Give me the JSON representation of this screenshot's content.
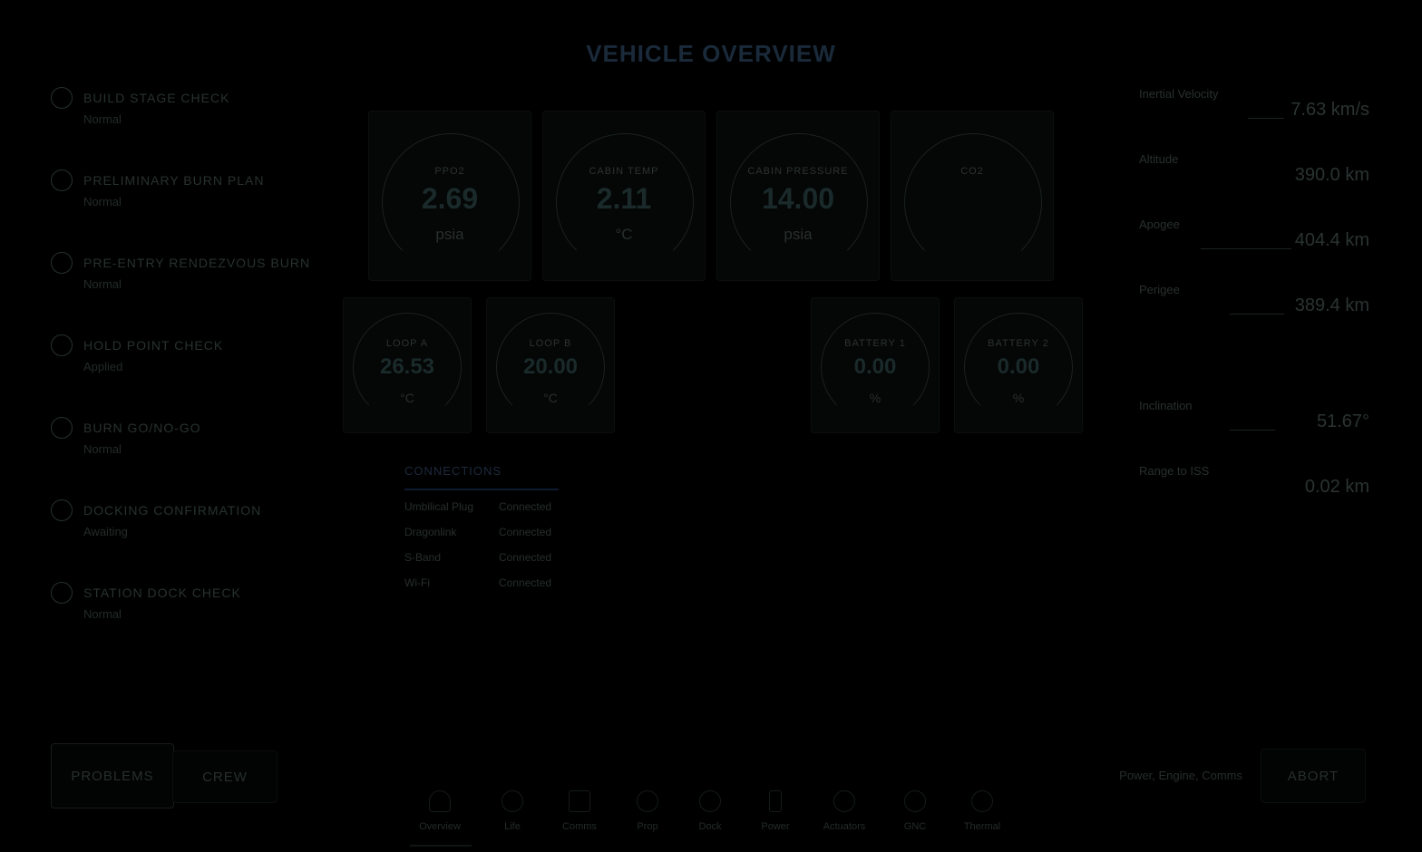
{
  "title": "VEHICLE OVERVIEW",
  "checklist": [
    {
      "name": "BUILD STAGE CHECK",
      "status": "Normal"
    },
    {
      "name": "PRELIMINARY BURN PLAN",
      "status": "Normal"
    },
    {
      "name": "PRE-ENTRY RENDEZVOUS BURN",
      "status": "Normal"
    },
    {
      "name": "HOLD POINT CHECK",
      "status": "Applied"
    },
    {
      "name": "BURN GO/NO-GO",
      "status": "Normal"
    },
    {
      "name": "DOCKING CONFIRMATION",
      "status": "Awaiting"
    },
    {
      "name": "STATION DOCK CHECK",
      "status": "Normal"
    }
  ],
  "gauges_top": [
    {
      "label": "PPO2",
      "value": "2.69",
      "unit": "psia"
    },
    {
      "label": "CABIN TEMP",
      "value": "2.11",
      "unit": "°C"
    },
    {
      "label": "CABIN PRESSURE",
      "value": "14.00",
      "unit": "psia"
    },
    {
      "label": "CO2",
      "value": "",
      "unit": ""
    }
  ],
  "gauges_bottom": [
    {
      "label": "LOOP A",
      "value": "26.53",
      "unit": "°C"
    },
    {
      "label": "LOOP B",
      "value": "20.00",
      "unit": "°C"
    },
    {
      "label": "BATTERY 1",
      "value": "0.00",
      "unit": "%"
    },
    {
      "label": "BATTERY 2",
      "value": "0.00",
      "unit": "%"
    }
  ],
  "telemetry": [
    {
      "label": "Inertial Velocity",
      "value": "7.63 km/s"
    },
    {
      "label": "Altitude",
      "value": "390.0 km"
    },
    {
      "label": "Apogee",
      "value": "404.4 km"
    },
    {
      "label": "Perigee",
      "value": "389.4 km"
    },
    {
      "label": "Inclination",
      "value": "51.67°"
    },
    {
      "label": "Range to ISS",
      "value": "0.02 km"
    }
  ],
  "connections": {
    "heading": "CONNECTIONS",
    "rows": [
      {
        "name": "Umbilical Plug",
        "status": "Connected"
      },
      {
        "name": "Dragonlink",
        "status": "Connected"
      },
      {
        "name": "S-Band",
        "status": "Connected"
      },
      {
        "name": "Wi-Fi",
        "status": "Connected"
      }
    ]
  },
  "buttons": {
    "left_outline": "PROBLEMS",
    "left_solid": "CREW",
    "right": "ABORT",
    "right_caption": "Power, Engine, Comms"
  },
  "nav": [
    {
      "label": "Overview",
      "icon": "capsule-icon"
    },
    {
      "label": "Life",
      "icon": "life-support-icon"
    },
    {
      "label": "Comms",
      "icon": "comms-icon"
    },
    {
      "label": "Prop",
      "icon": "propulsion-icon"
    },
    {
      "label": "Dock",
      "icon": "dock-icon"
    },
    {
      "label": "Power",
      "icon": "power-icon"
    },
    {
      "label": "Actuators",
      "icon": "actuator-icon"
    },
    {
      "label": "GNC",
      "icon": "gnc-icon"
    },
    {
      "label": "Thermal",
      "icon": "thermal-icon"
    }
  ]
}
